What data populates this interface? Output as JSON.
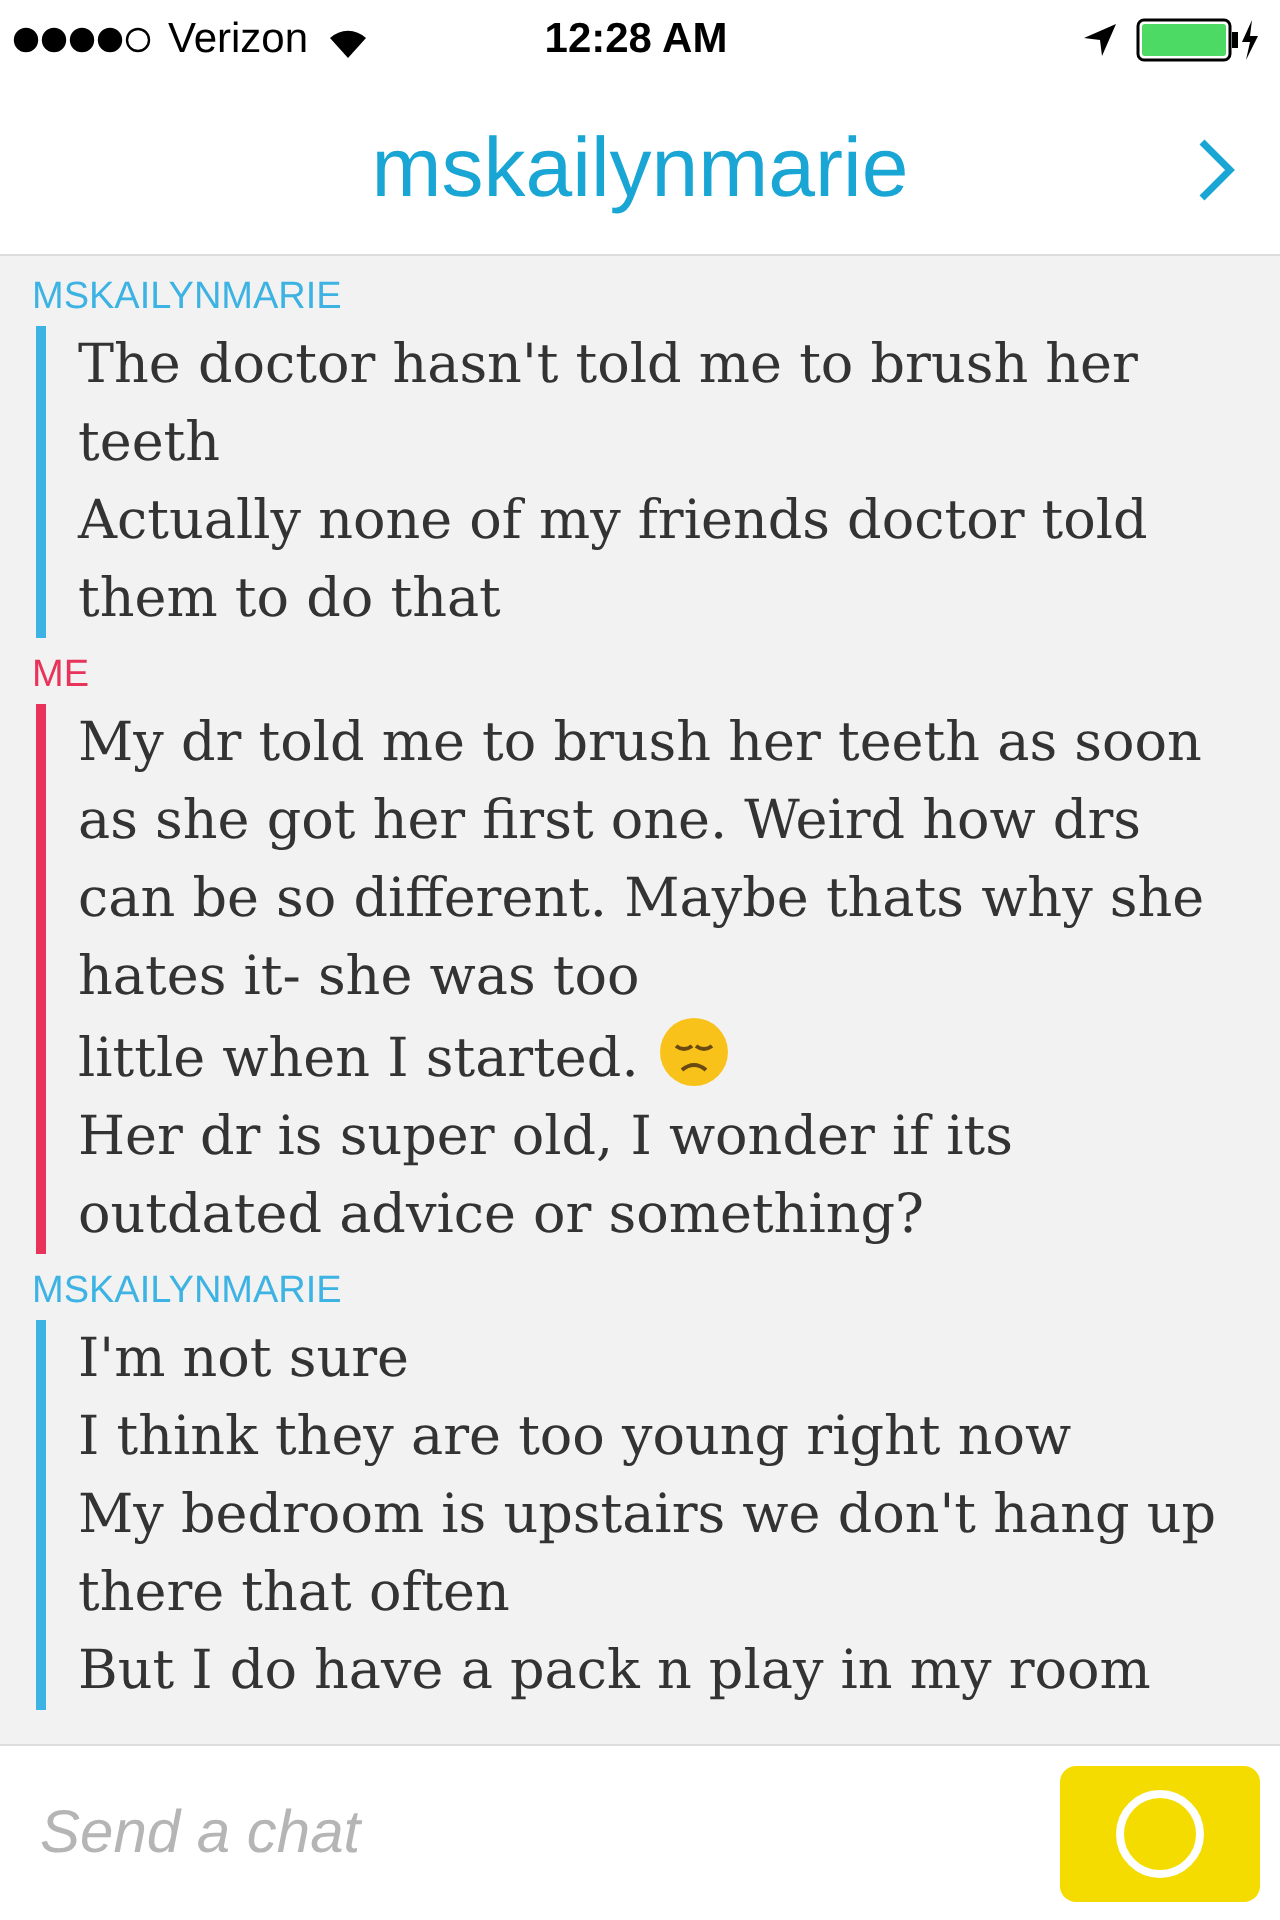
{
  "status_bar": {
    "carrier": "Verizon",
    "time": "12:28 AM"
  },
  "header": {
    "title": "mskailynmarie"
  },
  "messages": [
    {
      "sender": "MSKAILYNMARIE",
      "kind": "friend",
      "lines": [
        {
          "text": "The doctor hasn't told me to brush her teeth"
        },
        {
          "text": "Actually none of my friends doctor told them to do that"
        }
      ]
    },
    {
      "sender": "ME",
      "kind": "self",
      "lines": [
        {
          "text": "My dr told me to brush her teeth as soon as she got her first one. Weird how drs can be so different. Maybe thats why she hates it- she was too"
        },
        {
          "text": "little when I started.",
          "emoji": true
        },
        {
          "text": "Her dr is super old, I wonder if its outdated advice or something?"
        }
      ]
    },
    {
      "sender": "MSKAILYNMARIE",
      "kind": "friend",
      "lines": [
        {
          "text": "I'm not sure"
        },
        {
          "text": "I think they are too young right now"
        },
        {
          "text": "My bedroom is upstairs we don't hang up there that often"
        },
        {
          "text": "But I do have a pack n play in my room"
        }
      ]
    }
  ],
  "composer": {
    "placeholder": "Send a chat"
  }
}
